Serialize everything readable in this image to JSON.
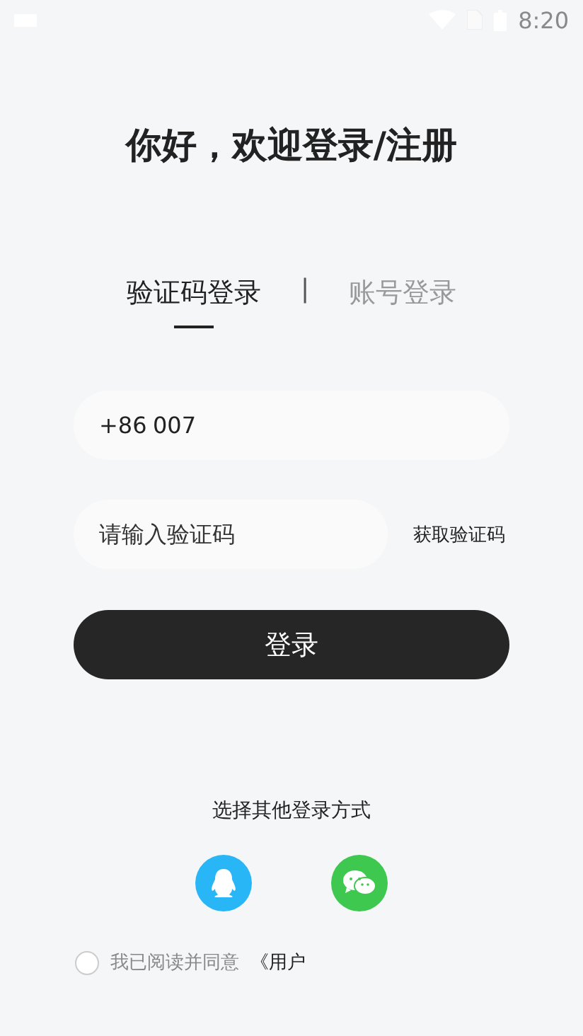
{
  "status_bar": {
    "time": "8:20"
  },
  "title": "你好，欢迎登录/注册",
  "tabs": [
    {
      "label": "验证码登录",
      "selected": true
    },
    {
      "label": "账号登录",
      "selected": false
    }
  ],
  "tab_separator": "|",
  "phone_field": {
    "country_code": "+86",
    "value": "007"
  },
  "code_field": {
    "placeholder": "请输入验证码"
  },
  "get_code_button": "获取验证码",
  "login_button": "登录",
  "other_login": {
    "label": "选择其他登录方式",
    "options": [
      {
        "kind": "qq",
        "color": "#29b6f6"
      },
      {
        "kind": "wechat",
        "color": "#3ec850"
      }
    ]
  },
  "agreement": {
    "checked": false,
    "text": "我已阅读并同意",
    "link": "《用户"
  }
}
